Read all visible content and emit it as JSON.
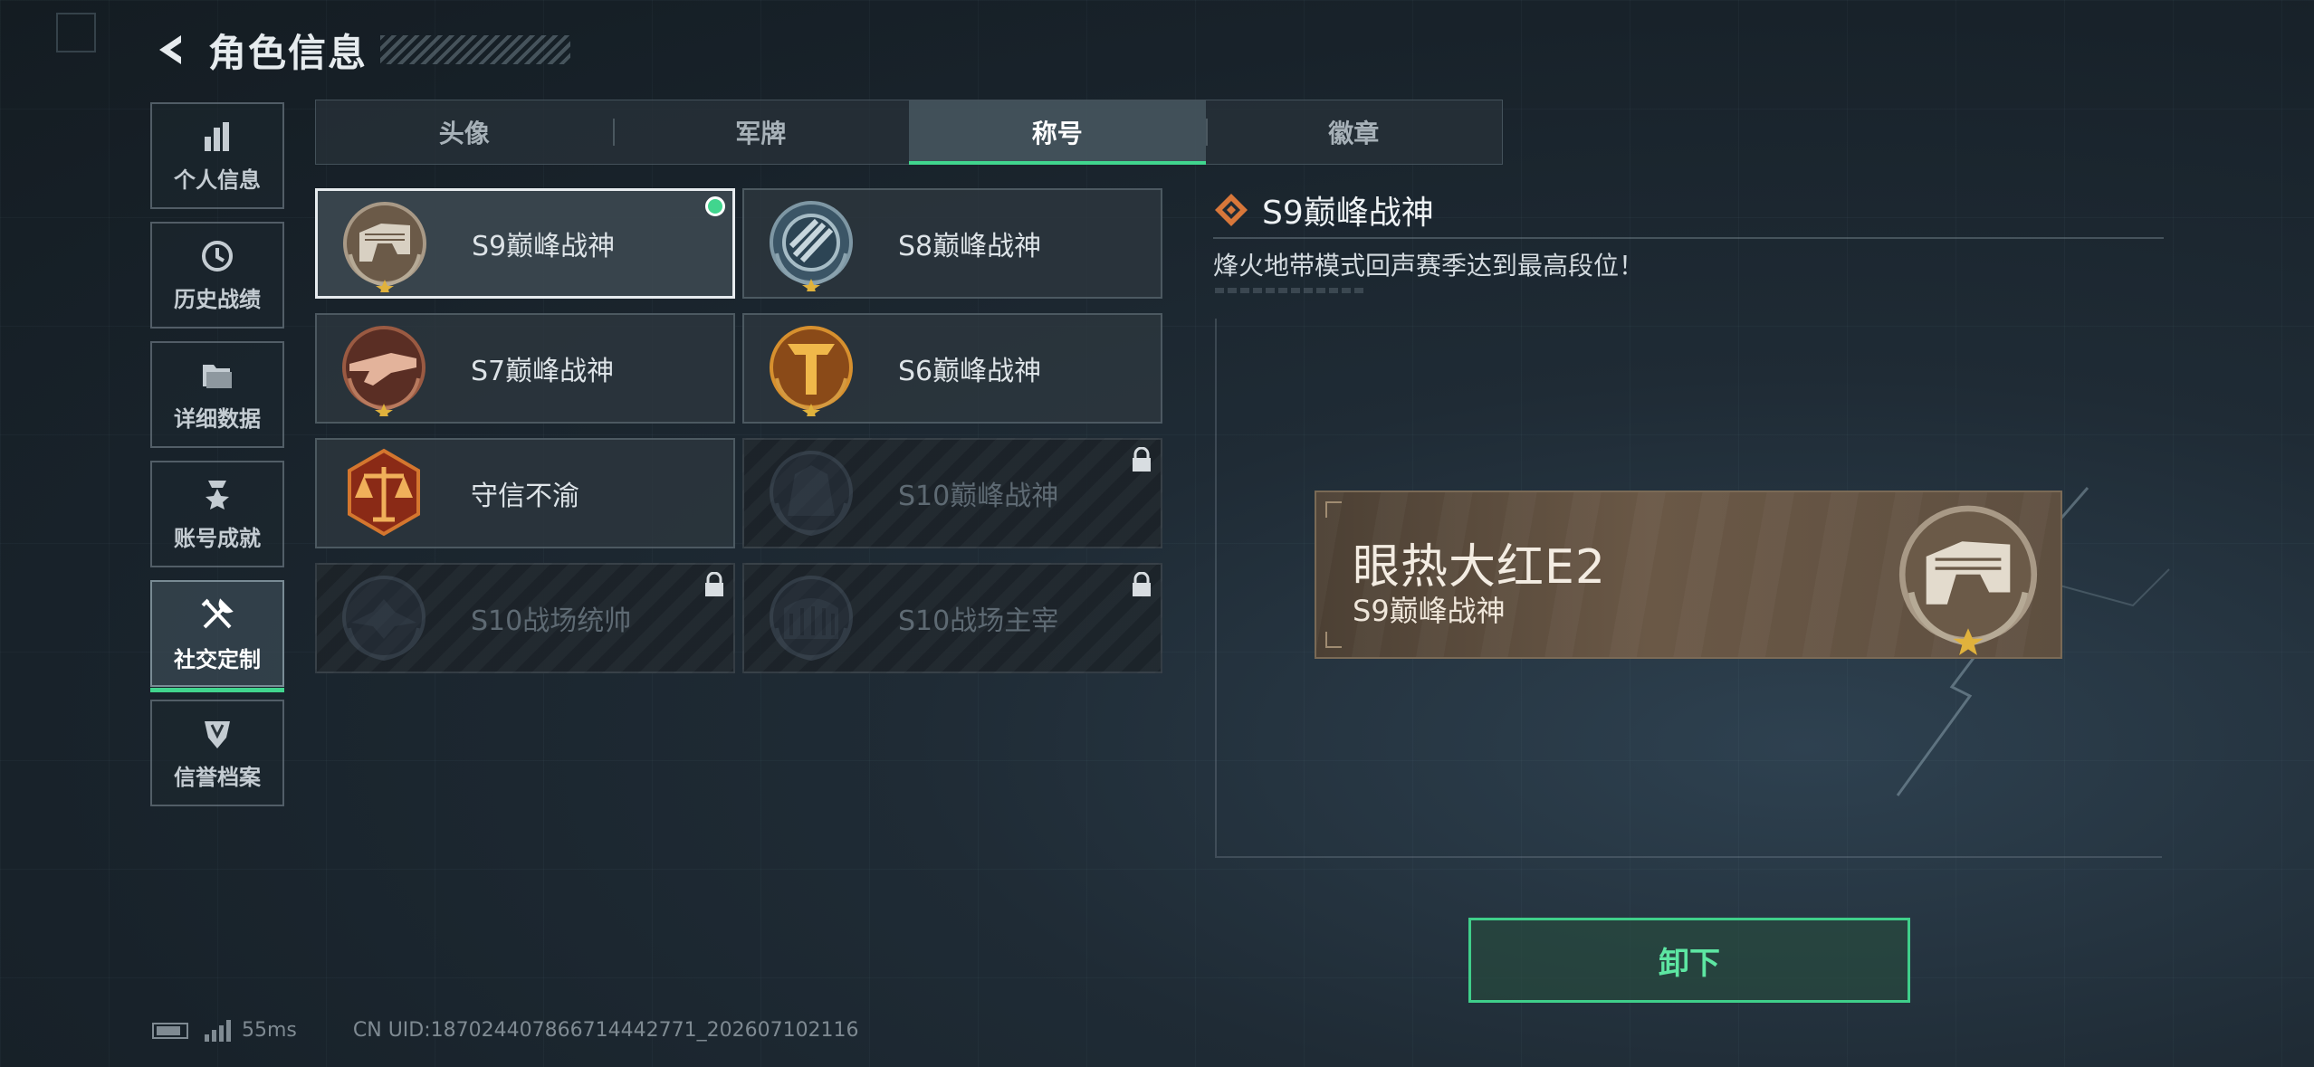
{
  "header": {
    "title": "角色信息"
  },
  "sidebar": {
    "items": [
      {
        "label": "个人信息",
        "icon": "bar-chart-icon"
      },
      {
        "label": "历史战绩",
        "icon": "history-clock-icon"
      },
      {
        "label": "详细数据",
        "icon": "folder-icon"
      },
      {
        "label": "账号成就",
        "icon": "medal-icon"
      },
      {
        "label": "社交定制",
        "icon": "tools-icon",
        "active": true
      },
      {
        "label": "信誉档案",
        "icon": "credit-shield-icon"
      }
    ]
  },
  "tabs": [
    {
      "label": "头像"
    },
    {
      "label": "军牌"
    },
    {
      "label": "称号",
      "active": true
    },
    {
      "label": "徽章"
    }
  ],
  "titles": [
    {
      "name": "S9巅峰战神",
      "state": "equipped"
    },
    {
      "name": "S8巅峰战神",
      "state": "owned"
    },
    {
      "name": "S7巅峰战神",
      "state": "owned"
    },
    {
      "name": "S6巅峰战神",
      "state": "owned"
    },
    {
      "name": "守信不渝",
      "state": "owned"
    },
    {
      "name": "S10巅峰战神",
      "state": "locked"
    },
    {
      "name": "S10战场统帅",
      "state": "locked"
    },
    {
      "name": "S10战场主宰",
      "state": "locked"
    }
  ],
  "detail": {
    "title": "S9巅峰战神",
    "description": "烽火地带模式回声赛季达到最高段位！",
    "preview": {
      "player_name": "眼热大红E2",
      "title": "S9巅峰战神"
    },
    "action_label": "卸下"
  },
  "footer": {
    "ping": "55ms",
    "uid": "CN UID:187024407866714442771_202607102116"
  },
  "colors": {
    "accent": "#41d58e",
    "text": "#e6ebee",
    "locked": "#5e6a73"
  }
}
